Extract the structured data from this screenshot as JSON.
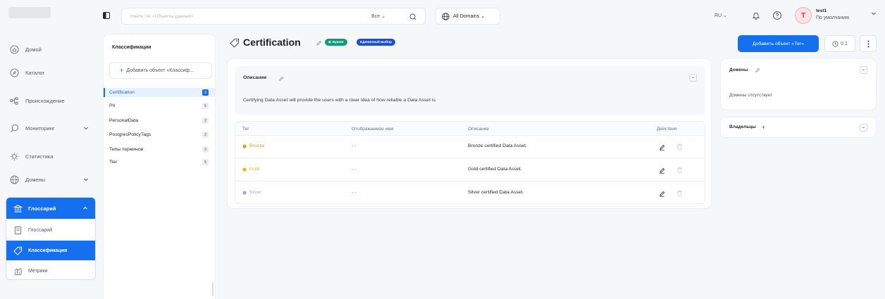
{
  "nav": {
    "items": [
      {
        "label": "Домой",
        "icon": "home-icon"
      },
      {
        "label": "Каталог",
        "icon": "compass-icon"
      },
      {
        "label": "Происхождение",
        "icon": "lineage-icon"
      },
      {
        "label": "Мониторинг",
        "icon": "monitor-icon"
      },
      {
        "label": "Статистика",
        "icon": "bulb-icon"
      },
      {
        "label": "Домены",
        "icon": "globe-icon"
      }
    ],
    "glossary": {
      "label": "Глоссарий",
      "subitems": [
        {
          "label": "Глоссарий",
          "icon": "book-icon"
        },
        {
          "label": "Классификация",
          "icon": "tag-icon"
        },
        {
          "label": "Метрики",
          "icon": "metrics-icon"
        }
      ]
    }
  },
  "topbar": {
    "search_placeholder": "Найти тег «Объекты данных»",
    "scope": "Все ⌄",
    "domains": "All Domains ⌄",
    "language": "RU ⌄",
    "avatar_letter": "T",
    "user_name": "test1",
    "user_role": "По умолчанию"
  },
  "classifications": {
    "title": "Классификации",
    "add_label": "Добавить объект «Классиф...",
    "items": [
      {
        "name": "Certification",
        "count": "3"
      },
      {
        "name": "PII",
        "count": "5"
      },
      {
        "name": "PersonalData",
        "count": "2"
      },
      {
        "name": "PostgresPolicyTags",
        "count": "2"
      },
      {
        "name": "Типы терминов",
        "count": "3"
      },
      {
        "name": "Tier",
        "count": "5"
      }
    ]
  },
  "header": {
    "title": "Certification",
    "badge_system": "Бушин",
    "badge_exclusive": "Единичный выбор",
    "add_tag_button": "Добавить объект «Тег»",
    "version": "0.1"
  },
  "description": {
    "label": "Описание",
    "text": "Certifying Data Asset will provide the users with a clear idea of how reliable a Data Asset is."
  },
  "tags_table": {
    "columns": [
      "Тег",
      "Отображаемое имя",
      "Описание",
      "Действия"
    ],
    "rows": [
      {
        "tag": "Bronze",
        "display_name": "- -",
        "description": "Bronze certified Data Asset.",
        "color": "#d99a3a"
      },
      {
        "tag": "Gold",
        "display_name": "- -",
        "description": "Gold certified Data Asset.",
        "color": "#f2b705"
      },
      {
        "tag": "Silver",
        "display_name": "- -",
        "description": "Silver certified Data Asset.",
        "color": "#a8adb5"
      }
    ]
  },
  "side": {
    "domains_title": "Домены",
    "domains_empty": "Домены отсутствует",
    "owners_title": "Владельцы",
    "owners_add": "+"
  },
  "colors": {
    "accent": "#1470ef",
    "system_badge": "#0f9c7b",
    "exclusive_badge": "#1f4fd6"
  }
}
